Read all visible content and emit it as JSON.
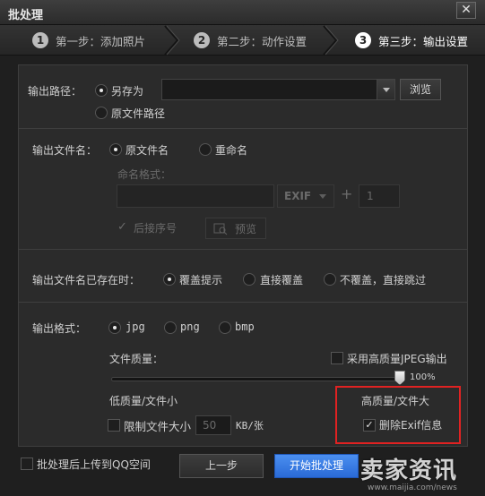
{
  "window": {
    "title": "批处理",
    "close_glyph": "✕"
  },
  "steps": [
    {
      "num": "1",
      "label": "第一步：添加照片",
      "active": false
    },
    {
      "num": "2",
      "label": "第二步：动作设置",
      "active": false
    },
    {
      "num": "3",
      "label": "第三步：输出设置",
      "active": true
    }
  ],
  "output_path": {
    "label": "输出路径：",
    "option_save_as": "另存为",
    "option_original": "原文件路径",
    "path_value": "",
    "browse_label": "浏览",
    "selected": "另存为"
  },
  "output_filename": {
    "label": "输出文件名：",
    "option_original": "原文件名",
    "option_rename": "重命名",
    "selected": "原文件名",
    "naming_format_label": "命名格式：",
    "exif_label": "EXIF",
    "plus_glyph": "+",
    "start_number": "1",
    "sequence_label": "后接序号",
    "preview_label": "预览"
  },
  "existing_file": {
    "label": "输出文件名已存在时：",
    "option_prompt": "覆盖提示",
    "option_overwrite": "直接覆盖",
    "option_skip": "不覆盖，直接跳过",
    "selected": "覆盖提示"
  },
  "output_format": {
    "label": "输出格式：",
    "options": [
      "jpg",
      "png",
      "bmp"
    ],
    "selected": "jpg",
    "quality_label": "文件质量：",
    "high_quality_jpeg_label": "采用高质量JPEG输出",
    "high_quality_jpeg_checked": false,
    "quality_percent": "100%",
    "quality_value": 1.0,
    "low_label": "低质量/文件小",
    "high_label": "高质量/文件大",
    "limit_size_label": "限制文件大小",
    "limit_size_checked": false,
    "limit_size_value": "50",
    "limit_size_unit": "KB/张",
    "remove_exif_label": "删除Exif信息",
    "remove_exif_checked": true
  },
  "footer": {
    "upload_qq_label": "批处理后上传到QQ空间",
    "upload_qq_checked": false,
    "prev_label": "上一步",
    "start_label": "开始批处理"
  },
  "watermark": {
    "text": "卖家资讯",
    "url": "www.maijia.com/news"
  },
  "colors": {
    "accent": "#2a6ad6",
    "highlight": "#e02222"
  }
}
